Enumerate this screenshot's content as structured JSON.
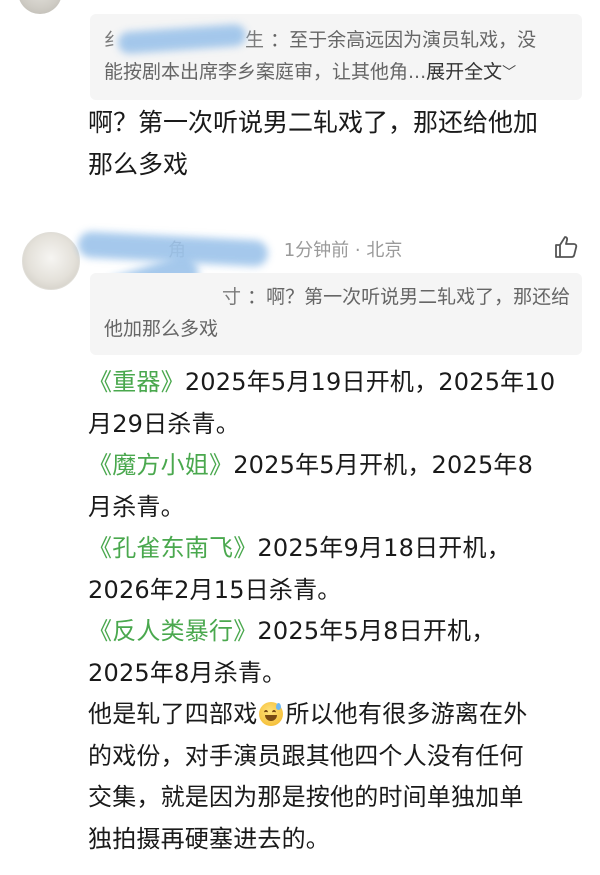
{
  "first_comment": {
    "quote": {
      "name_fragment": "纟",
      "name_tail": "生",
      "text_line1": "：至于余高远因为演员轧戏，没",
      "text_line2": "能按剧本出席李乡案庭审，让其他角...",
      "expand_label": "展开全文",
      "expand_icon": "chevron-down-icon"
    },
    "text_line1": "啊？第一次听说男二轧戏了，那还给他加",
    "text_line2": "那么多戏"
  },
  "second_comment": {
    "name_fragment": "角",
    "time": "1分钟前",
    "separator": "·",
    "location": "北京",
    "like_icon": "thumbs-up-icon",
    "quote": {
      "name_tail": "寸",
      "text_line1": "：啊？第一次听说男二轧戏了，那还给",
      "text_line2": "他加那么多戏"
    },
    "lines": [
      {
        "book": "《重器》",
        "text": "2025年5月19日开机，2025年10"
      },
      {
        "text": "月29日杀青。"
      },
      {
        "book": "《魔方小姐》",
        "text": "2025年5月开机，2025年8"
      },
      {
        "text": "月杀青。"
      },
      {
        "book": "《孔雀东南飞》",
        "text": "2025年9月18日开机，"
      },
      {
        "text": "2026年2月15日杀青。"
      },
      {
        "book": "《反人类暴行》",
        "text": "2025年5月8日开机，"
      },
      {
        "text": "2025年8月杀青。"
      }
    ],
    "closing_line1_a": "他是轧了四部戏",
    "closing_line1_b": "所以他有很多游离在外",
    "closing_line2": "的戏份，对手演员跟其他四个人没有任何",
    "closing_line3": "交集，就是因为那是按他的时间单独加单",
    "closing_line4": "独拍摄再硬塞进去的。",
    "emoji_icon": "sweat-smile-emoji-icon"
  },
  "colors": {
    "book_title": "#4aa84e",
    "quote_bg": "#f5f5f5",
    "meta_gray": "#9a9a9a",
    "blur_blue": "#9cc3ea"
  }
}
